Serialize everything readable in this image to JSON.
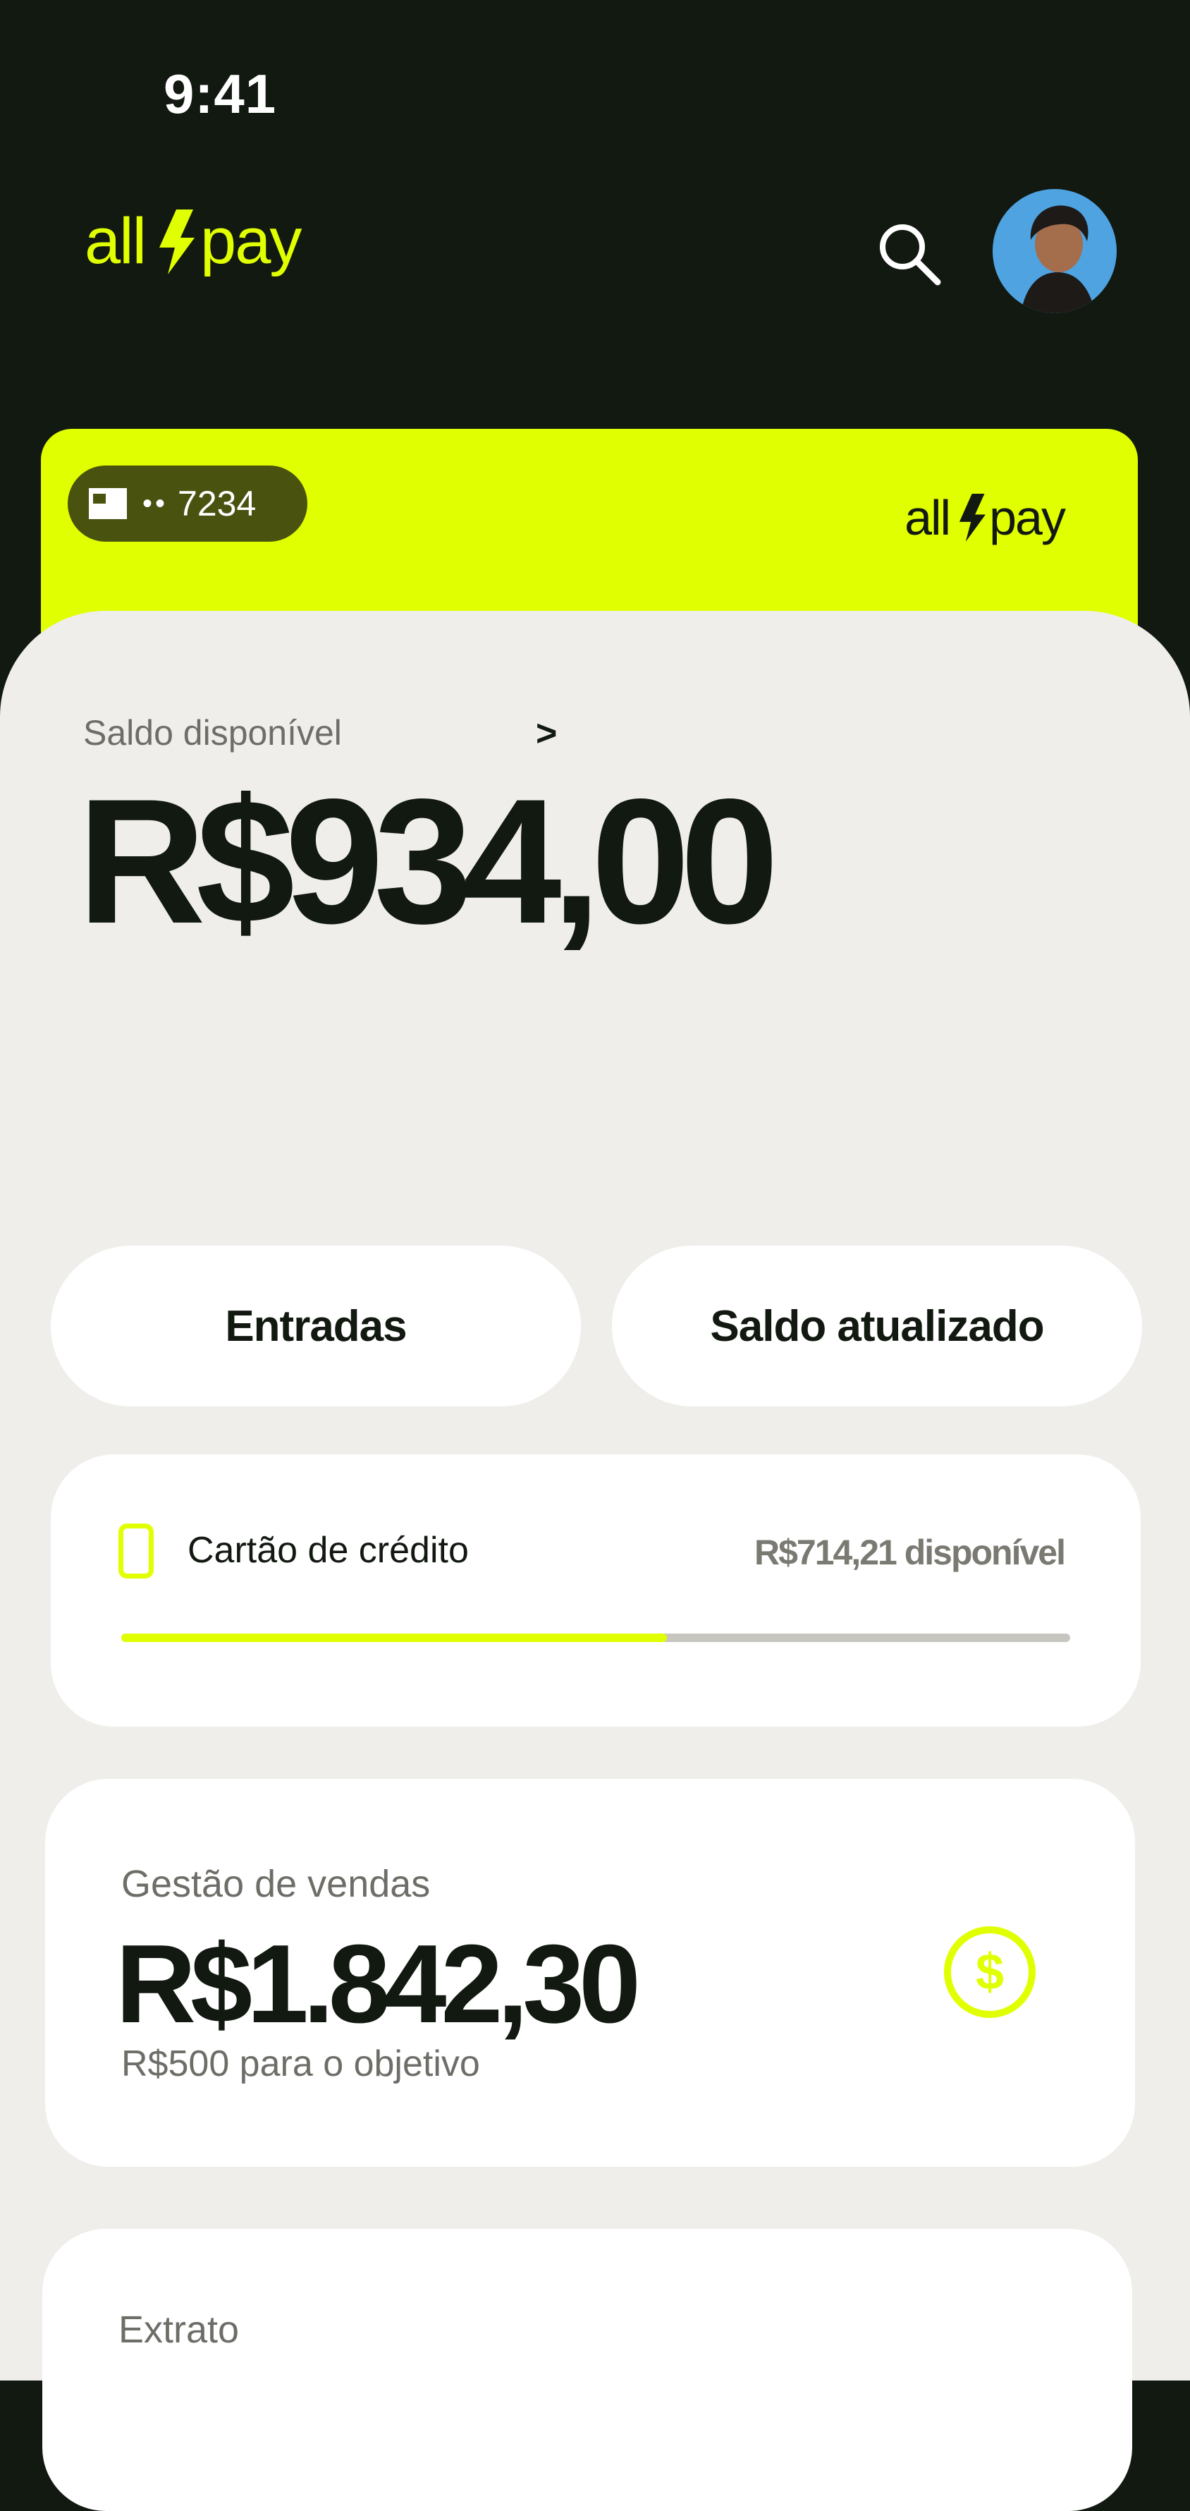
{
  "status_bar": {
    "time": "9:41"
  },
  "header": {
    "brand_left": "all",
    "brand_right": "pay",
    "colors": {
      "background": "#121911",
      "accent": "#e0ff00"
    },
    "search_icon": "search-icon",
    "avatar_icon": "user-avatar"
  },
  "card": {
    "masked_dots": "••",
    "last_digits": "7234",
    "brand_left": "all",
    "brand_right": "pay",
    "color": "#e0ff00"
  },
  "balance": {
    "label": "Saldo disponível",
    "chevron": ">",
    "value": "R$934,00"
  },
  "actions": {
    "entradas": "Entradas",
    "saldo_atualizado": "Saldo atualizado"
  },
  "credit": {
    "label": "Cartão de crédito",
    "available": "R$714,21 disponível",
    "usage_fraction": 0.575
  },
  "sales": {
    "label": "Gestão de vendas",
    "value": "R$1.842,30",
    "goal": "R$500 para o objetivo",
    "icon": "dollar-circle-icon"
  },
  "statement": {
    "label": "Extrato"
  }
}
